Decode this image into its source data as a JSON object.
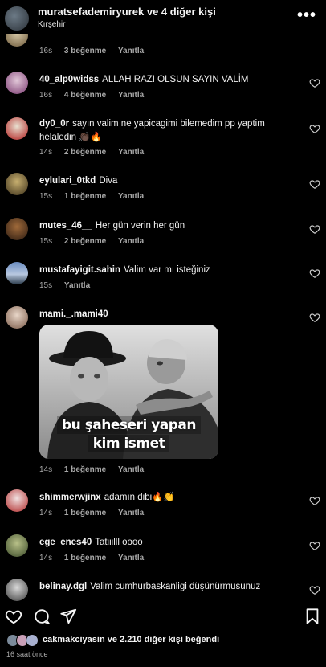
{
  "header": {
    "title": "muratsefademiryurek ve 4 diğer kişi",
    "subtitle": "Kırşehir",
    "more_icon": "more-horizontal-icon"
  },
  "comments": [
    {
      "user": "",
      "text": "",
      "time": "16s",
      "likes": "3 beğenme",
      "reply": "Yanıtla"
    },
    {
      "user": "40_alp0widss",
      "text": "ALLAH RAZI OLSUN SAYIN VALİM",
      "time": "16s",
      "likes": "4 beğenme",
      "reply": "Yanıtla"
    },
    {
      "user": "dy0_0r",
      "text": "sayın valim ne yapicagimi bilemedim pp yaptim helaledin 👏🏿🔥",
      "time": "14s",
      "likes": "2 beğenme",
      "reply": "Yanıtla"
    },
    {
      "user": "eylulari_0tkd",
      "text": "Diva",
      "time": "15s",
      "likes": "1 beğenme",
      "reply": "Yanıtla"
    },
    {
      "user": "mutes_46__",
      "text": "Her gün verin her gün",
      "time": "15s",
      "likes": "2 beğenme",
      "reply": "Yanıtla"
    },
    {
      "user": "mustafayigit.sahin",
      "text": "Valim var mı isteğiniz",
      "time": "15s",
      "likes": "",
      "reply": "Yanıtla"
    },
    {
      "user": "mami._.mami40",
      "text": "",
      "time": "14s",
      "likes": "1 beğenme",
      "reply": "Yanıtla"
    },
    {
      "user": "shimmerwjinx",
      "text": "adamın dibi🔥👏",
      "time": "14s",
      "likes": "1 beğenme",
      "reply": "Yanıtla"
    },
    {
      "user": "ege_enes40",
      "text": "Tatiiilll oooo",
      "time": "14s",
      "likes": "1 beğenme",
      "reply": "Yanıtla"
    },
    {
      "user": "belinay.dgl",
      "text": "Valim cumhurbaskanligi düşünürmusunuz",
      "time": "",
      "likes": "",
      "reply": ""
    }
  ],
  "meme": {
    "line1": "bu şaheseri yapan",
    "line2": "kim ismet"
  },
  "actions": {
    "like_icon": "heart-icon",
    "comment_icon": "comment-icon",
    "share_icon": "send-icon",
    "save_icon": "bookmark-icon"
  },
  "liked_by": {
    "user": "cakmakciyasin",
    "rest": "ve 2.210 diğer kişi beğendi"
  },
  "posted": "16 saat önce",
  "colors": {
    "background": "#000000",
    "text": "#f5f5f5",
    "secondary_text": "#a8a8a8"
  }
}
